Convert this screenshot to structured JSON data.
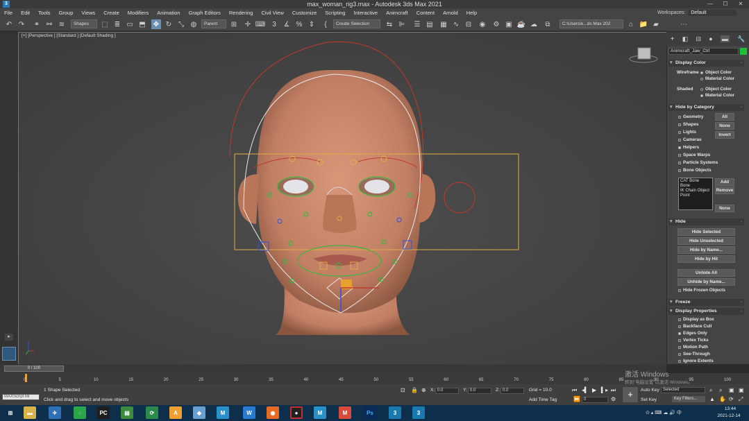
{
  "window": {
    "title": "max_woman_rig3.max - Autodesk 3ds Max 2021",
    "app_icon": "3"
  },
  "menu": [
    "File",
    "Edit",
    "Tools",
    "Group",
    "Views",
    "Create",
    "Modifiers",
    "Animation",
    "Graph Editors",
    "Rendering",
    "Civil View",
    "Customize",
    "Scripting",
    "Interactive",
    "Animcraft",
    "Content",
    "Arnold",
    "Help"
  ],
  "workspaces": {
    "label": "Workspaces:",
    "value": "Default"
  },
  "toolbar": {
    "filter_label": "Shapes",
    "ref_coord": "Parent",
    "selection_set": "Create Selection",
    "path": "C:\\Users\\k...ds Max 202"
  },
  "viewport": {
    "label": "[+] [Perspective ] [Standard ] [Default Shading ]"
  },
  "command_panel": {
    "object_name": "Animcraft_Jaw_Ctrl",
    "object_color": "#1dc03a",
    "display_color": {
      "header": "Display Color",
      "wireframe_label": "Wireframe",
      "shaded_label": "Shaded",
      "options": [
        "Object Color",
        "Material Color"
      ],
      "wireframe_selected": "Object Color",
      "shaded_selected": "Material Color"
    },
    "hide_by_category": {
      "header": "Hide by Category",
      "items": [
        {
          "label": "Geometry",
          "checked": false
        },
        {
          "label": "Shapes",
          "checked": false
        },
        {
          "label": "Lights",
          "checked": false
        },
        {
          "label": "Cameras",
          "checked": false
        },
        {
          "label": "Helpers",
          "checked": true
        },
        {
          "label": "Space Warps",
          "checked": false
        },
        {
          "label": "Particle Systems",
          "checked": false
        },
        {
          "label": "Bone Objects",
          "checked": false
        }
      ],
      "buttons": [
        "All",
        "None",
        "Invert"
      ],
      "list": [
        "CAT Bone",
        "Bone",
        "IK Chain Object",
        "Point"
      ],
      "list_buttons": [
        "Add",
        "Remove",
        "None"
      ]
    },
    "hide": {
      "header": "Hide",
      "buttons": [
        "Hide Selected",
        "Hide Unselected",
        "Hide by Name...",
        "Hide by Hit",
        "Unhide All",
        "Unhide by Name..."
      ],
      "check": "Hide Frozen Objects"
    },
    "freeze": {
      "header": "Freeze"
    },
    "display_properties": {
      "header": "Display Properties",
      "items": [
        {
          "label": "Display as Box",
          "checked": false
        },
        {
          "label": "Backface Cull",
          "checked": false
        },
        {
          "label": "Edges Only",
          "checked": true
        },
        {
          "label": "Vertex Ticks",
          "checked": false
        },
        {
          "label": "Motion Path",
          "checked": false
        },
        {
          "label": "See-Through",
          "checked": false
        },
        {
          "label": "Ignore Extents",
          "checked": false
        }
      ]
    }
  },
  "timeline": {
    "frame": "0 / 100",
    "ticks": [
      "0",
      "5",
      "10",
      "15",
      "20",
      "25",
      "30",
      "35",
      "40",
      "45",
      "50",
      "55",
      "60",
      "65",
      "70",
      "75",
      "80",
      "85",
      "90",
      "95",
      "100"
    ]
  },
  "status": {
    "maxscript": "MAXScript Mi",
    "selection": "1 Shape Selected",
    "prompt": "Click and drag to select and move objects",
    "x_label": "X:",
    "x": "0.0",
    "y_label": "Y:",
    "y": "0.0",
    "z_label": "Z:",
    "z": "0.0",
    "grid": "Grid = 10.0",
    "add_time_tag": "Add Time Tag",
    "frame_field": "0",
    "auto_key": "Auto Key",
    "selected": "Selected",
    "set_key": "Set Key",
    "key_filters": "Key Filters..."
  },
  "watermark": {
    "line1": "激活 Windows",
    "line2": "转到\"电脑设置\"以激活 Windows。"
  },
  "taskbar": {
    "time": "13:44",
    "date": "2021-12-14"
  }
}
